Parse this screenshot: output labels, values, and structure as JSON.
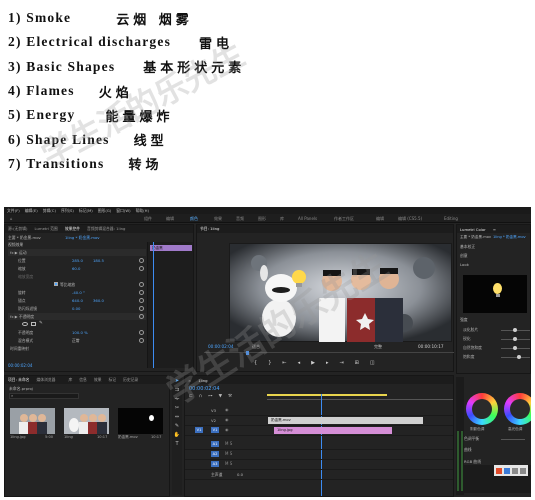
{
  "list": [
    {
      "num": "1)",
      "en": "Smoke",
      "zh": "云烟 烟雾"
    },
    {
      "num": "2)",
      "en": "Electrical discharges",
      "zh": "雷电"
    },
    {
      "num": "3)",
      "en": "Basic Shapes",
      "zh": "基本形状元素"
    },
    {
      "num": "4)",
      "en": "Flames",
      "zh": "火焰"
    },
    {
      "num": "5)",
      "en": "Energy",
      "zh": "能量爆炸"
    },
    {
      "num": "6)",
      "en": "Shape Lines",
      "zh": "线型"
    },
    {
      "num": "7)",
      "en": "Transitions",
      "zh": "转场"
    }
  ],
  "menu": [
    "文件(F)",
    "编辑(E)",
    "剪辑(C)",
    "序列(S)",
    "标记(M)",
    "图形(G)",
    "窗口(W)",
    "帮助(H)"
  ],
  "workspaces": [
    "组件",
    "编辑",
    "颜色",
    "效果",
    "音频",
    "图形",
    "库",
    "All Panels",
    "作者工作区",
    "编辑",
    "编辑 (CS5.5)",
    "Editing"
  ],
  "effect_controls": {
    "tabs": [
      "源:(无剪辑)",
      "Lumetri 范围",
      "效果控件",
      "音频剪辑混合器: 1ling"
    ],
    "clip": "主要 * 奶金黑.mov",
    "seq": "1ling * 奶金黑.mov",
    "section": "视频效果",
    "rows": [
      {
        "label": "fx ▶ 运动",
        "v1": "",
        "v2": ""
      },
      {
        "label": "位置",
        "v1": "285.0",
        "v2": "180.5"
      },
      {
        "label": "缩放",
        "v1": "60.0",
        "v2": ""
      },
      {
        "label": "缩放宽度",
        "v1": "",
        "v2": ""
      },
      {
        "label": "等比缩放",
        "v1": "",
        "v2": ""
      },
      {
        "label": "旋转",
        "v1": "-40.0 °",
        "v2": ""
      },
      {
        "label": "锚点",
        "v1": "640.0",
        "v2": "360.0"
      },
      {
        "label": "防闪烁滤镜",
        "v1": "0.00",
        "v2": ""
      },
      {
        "label": "fx ▶ 不透明度",
        "v1": "",
        "v2": ""
      },
      {
        "label": "不透明度",
        "v1": "100.0 %",
        "v2": ""
      },
      {
        "label": "混合模式",
        "v1": "正常",
        "v2": ""
      },
      {
        "label": "时间重映射",
        "v1": "",
        "v2": ""
      }
    ],
    "timecode": "00:00:02:04",
    "mini_clip": "奶金黑"
  },
  "program": {
    "tab": "节目: 1ling",
    "timecode": "00:00:02:04",
    "fit": "适合",
    "quality": "完整",
    "duration": "00:00:10:17"
  },
  "project": {
    "tabs": [
      "项目: 未命名",
      "媒体浏览器",
      "库",
      "信息",
      "效果",
      "标记",
      "历史记录"
    ],
    "file": "未命名.prproj",
    "items": [
      {
        "name": "1ling.jpg",
        "dur": "5:00"
      },
      {
        "name": "1ling",
        "dur": "10:17"
      },
      {
        "name": "奶金黑.mov",
        "dur": "10:17"
      }
    ]
  },
  "timeline": {
    "tab": "1ling",
    "timecode": "00:00:02:04",
    "tracks": [
      "V3",
      "V2",
      "V1",
      "A1",
      "A2",
      "A3",
      "主声道"
    ],
    "clip_top": "奶金黑.mov",
    "clip_bottom": "1ling.jpg",
    "master_value": "0.0"
  },
  "lumetri": {
    "tabs": [
      "Lumetri Color",
      "≡"
    ],
    "clip": "主要 * 奶金黑.mov",
    "seq": "1ling * 奶金黑.mov",
    "sections": [
      "基本校正",
      "创意",
      "Look",
      "强度"
    ],
    "sliders": [
      "淡化胶片",
      "锐化",
      "自然饱和度",
      "饱和度"
    ],
    "wheels": [
      "阴影色调",
      "高光色调"
    ],
    "balance": "色调平衡",
    "curves": "曲线",
    "rgb": "RGB 曲线"
  },
  "watermark": "学生活的乐先生",
  "colors": {
    "accent_blue": "#4ea6ff",
    "clip_pink": "#d58ed6",
    "clip_gray": "#d0d0d0",
    "playhead": "#3d8cf2"
  }
}
